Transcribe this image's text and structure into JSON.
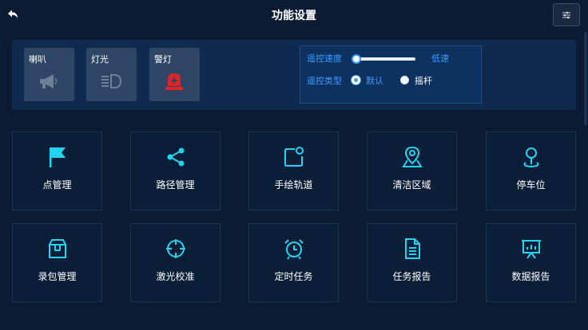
{
  "header": {
    "title": "功能设置",
    "back_icon": "back-arrow-icon",
    "settings_icon": "sliders-icon"
  },
  "devices": [
    {
      "label": "喇叭",
      "icon": "megaphone-icon"
    },
    {
      "label": "灯光",
      "icon": "headlight-icon"
    },
    {
      "label": "警灯",
      "icon": "warning-light-icon"
    }
  ],
  "remote": {
    "speed_label": "遥控速度",
    "speed_value": "低速",
    "speed_level": 0.0,
    "type_label": "遥控类型",
    "type_options": [
      {
        "label": "默认",
        "selected": true
      },
      {
        "label": "摇杆",
        "selected": false
      }
    ]
  },
  "tiles": [
    {
      "label": "点管理",
      "icon": "flag-icon"
    },
    {
      "label": "路径管理",
      "icon": "share-icon"
    },
    {
      "label": "手绘轨道",
      "icon": "draw-track-icon"
    },
    {
      "label": "清洁区域",
      "icon": "location-area-icon"
    },
    {
      "label": "停车位",
      "icon": "parking-pin-icon"
    },
    {
      "label": "录包管理",
      "icon": "package-icon"
    },
    {
      "label": "激光校准",
      "icon": "crosshair-icon"
    },
    {
      "label": "定时任务",
      "icon": "alarm-clock-icon"
    },
    {
      "label": "任务报告",
      "icon": "document-icon"
    },
    {
      "label": "数据报告",
      "icon": "presentation-chart-icon"
    }
  ],
  "colors": {
    "background": "#0a1b33",
    "panel": "#0e2a4e",
    "accent": "#3a9cff",
    "icon_cyan": "#21d4f2",
    "alarm_red": "#e02424",
    "device_button": "#2f4565"
  }
}
